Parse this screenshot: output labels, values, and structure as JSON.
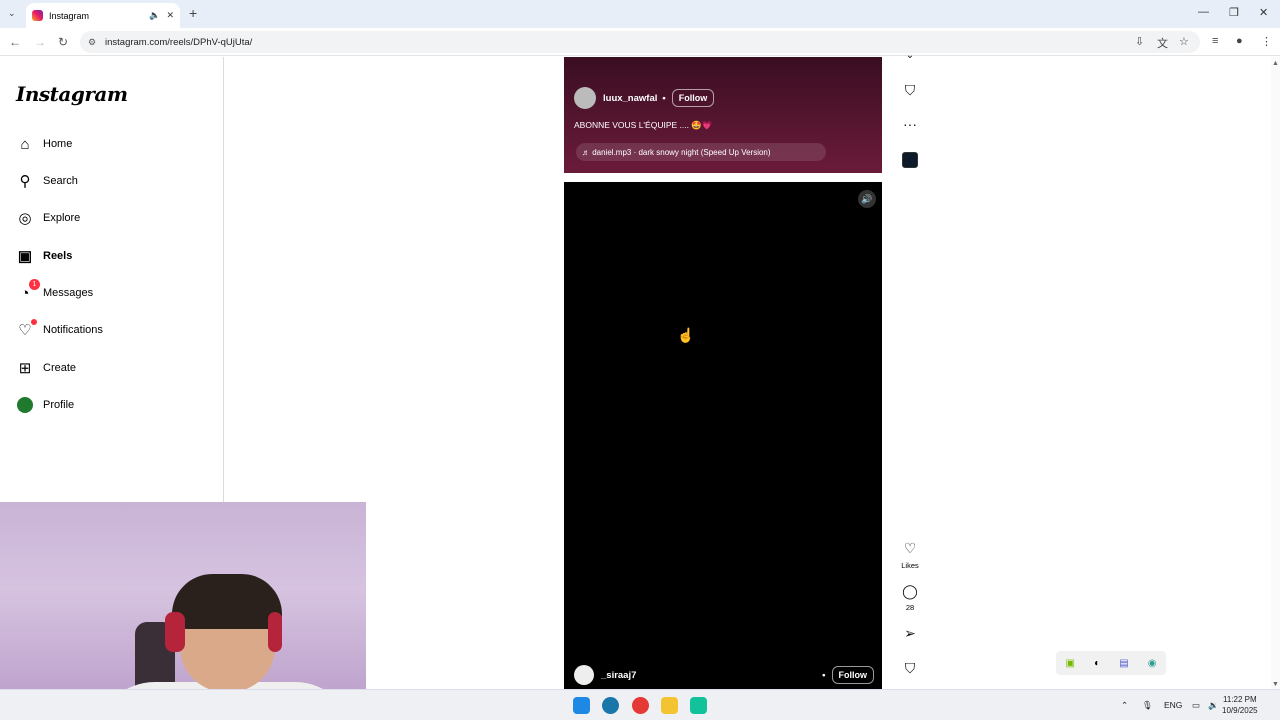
{
  "browser": {
    "tab_title": "Instagram",
    "tab_audio_icon": "speaker-icon",
    "tab_close": "✕",
    "new_tab": "+",
    "url": "instagram.com/reels/DPhV-qUjUta/"
  },
  "sidebar": {
    "logo": "Instagram",
    "items": [
      {
        "label": "Home",
        "icon": "home-icon"
      },
      {
        "label": "Search",
        "icon": "search-icon"
      },
      {
        "label": "Explore",
        "icon": "compass-icon"
      },
      {
        "label": "Reels",
        "icon": "reels-icon"
      },
      {
        "label": "Messages",
        "icon": "messenger-icon",
        "badge": "1"
      },
      {
        "label": "Notifications",
        "icon": "heart-icon"
      },
      {
        "label": "Create",
        "icon": "plus-square-icon"
      },
      {
        "label": "Profile",
        "icon": "avatar"
      }
    ]
  },
  "reel_top": {
    "username": "luux_nawfal",
    "separator": "•",
    "follow": "Follow",
    "caption": "ABONNE VOUS L'ÉQUIPE .... 🤩💗",
    "audio": "♬ daniel.mp3 · dark snowy night (Speed Up Version)"
  },
  "reel_main": {
    "username": "_siraaj7",
    "separator": "•",
    "follow": "Follow"
  },
  "actions": {
    "likes_label": "Likes",
    "comments_count": "28"
  },
  "taskbar": {
    "lang": "ENG",
    "time": "11:22 PM",
    "date": "10/9/2025"
  },
  "colors": {
    "badge": "#ff3040",
    "reel_top_bg": "#5a1733",
    "sidebar_border": "#dbdbdb"
  }
}
